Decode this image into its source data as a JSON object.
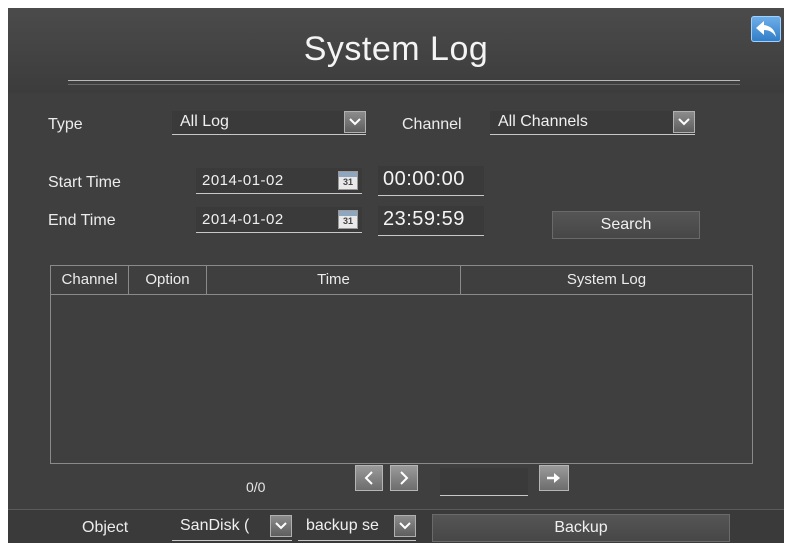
{
  "header": {
    "title": "System Log"
  },
  "filters": {
    "type_label": "Type",
    "type_value": "All Log",
    "channel_label": "Channel",
    "channel_value": "All Channels",
    "start_label": "Start Time",
    "start_date": "2014-01-02",
    "start_time": "00:00:00",
    "end_label": "End Time",
    "end_date": "2014-01-02",
    "end_time": "23:59:59",
    "calendar_day": "31",
    "search_label": "Search"
  },
  "table": {
    "columns": [
      "Channel",
      "Option",
      "Time",
      "System Log"
    ],
    "rows": []
  },
  "pager": {
    "text": "0/0"
  },
  "footer": {
    "object_label": "Object",
    "device_value": "SanDisk (",
    "backup_select_value": "backup se",
    "backup_label": "Backup"
  },
  "icons": {
    "back": "back-arrow-icon",
    "dropdown": "chevron-down-icon",
    "calendar": "calendar-icon",
    "prev": "chevron-left-icon",
    "next": "chevron-right-icon",
    "go": "arrow-right-icon"
  },
  "colors": {
    "background": "#3f3f3f",
    "accent": "#3a8fe0"
  }
}
